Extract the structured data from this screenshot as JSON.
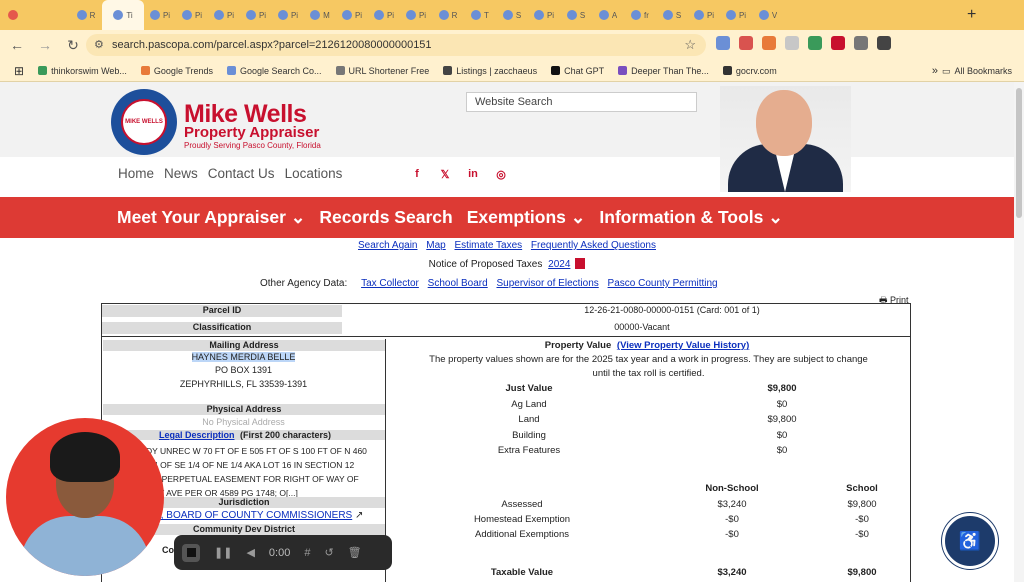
{
  "browser": {
    "tab_labels": [
      "R",
      "Ti",
      "Pi",
      "Pi",
      "Pi",
      "Pi",
      "Pi",
      "M",
      "Pi",
      "Pi",
      "Pi",
      "R",
      "T",
      "S",
      "Pi",
      "S",
      "A",
      "fr",
      "S",
      "Pi",
      "Pi",
      "V"
    ],
    "active_tab_label": "Pı",
    "url": "search.pascopa.com/parcel.aspx?parcel=2126120080000000151",
    "bookmarks": [
      "thinkorswim Web...",
      "Google Trends",
      "Google Search Co...",
      "URL Shortener Free",
      "Listings | zacchaeus",
      "Chat GPT",
      "Deeper Than The...",
      "gocrv.com"
    ],
    "all_bookmarks_label": "All Bookmarks"
  },
  "site": {
    "brand_name": "Mike Wells",
    "brand_sub": "Property Appraiser",
    "brand_tag": "Proudly Serving Pasco County, Florida",
    "seal_text": "PASCO COUNTY PROPERTY APPRAISER",
    "seal_mini_name": "MIKE WELLS",
    "search_placeholder": "Website Search",
    "nav_links": [
      "Home",
      "News",
      "Contact Us",
      "Locations"
    ],
    "social_icons": [
      "facebook-icon",
      "x-icon",
      "linkedin-icon",
      "instagram-icon"
    ],
    "main_nav": [
      "Meet Your Appraiser ⌄",
      "Records Search",
      "Exemptions ⌄",
      "Information & Tools ⌄"
    ]
  },
  "parcel_page": {
    "sub_links": [
      "Search Again",
      "Map",
      "Estimate Taxes",
      "Frequently Asked Questions"
    ],
    "notice_text": "Notice of Proposed Taxes",
    "notice_year": "2024",
    "agency_label": "Other Agency Data:",
    "agency_links": [
      "Tax Collector",
      "School Board",
      "Supervisor of Elections",
      "Pasco County Permitting"
    ],
    "print_label": "Print",
    "parcel_id_label": "Parcel ID",
    "parcel_id_value": "12-26-21-0080-00000-0151  (Card: 001 of 1)",
    "classification_label": "Classification",
    "classification_value": "00000-Vacant",
    "mailing_address_label": "Mailing Address",
    "owner_name": "HAYNES MERDIA BELLE",
    "mailing_line2": "PO BOX 1391",
    "mailing_line3": "ZEPHYRHILLS, FL 33539-1391",
    "physical_address_label": "Physical Address",
    "physical_address_value": "No Physical Address",
    "legal_desc_link": "Legal Description",
    "legal_desc_suffix": "(First 200 characters)",
    "legal_desc_lines": [
      "DY UNREC W 70 FT OF E 505 FT OF S 100 FT OF N 460",
      "1/4 OF SE 1/4 OF NE 1/4 AKA LOT 16 IN SECTION 12",
      "D A PERPETUAL EASEMENT FOR RIGHT OF WAY OF",
      "ILEY AVE PER OR 4589 PG 1748; O[...]"
    ],
    "jurisdiction_label": "Jurisdiction",
    "jurisdiction_value": "NTY, BOARD OF COUNTY COMMISSIONERS",
    "community_dev_label": "Community Dev District",
    "partial_label": "Co",
    "property_value_label": "Property Value",
    "value_history_link": "(View Property Value History)",
    "value_note_1": "The property values shown are for the 2025 tax year and a work in progress. They are subject to change",
    "value_note_2": "until the tax roll is certified.",
    "just_value_label": "Just Value",
    "just_value": "$9,800",
    "ag_land_label": "Ag Land",
    "ag_land": "$0",
    "land_label": "Land",
    "land": "$9,800",
    "building_label": "Building",
    "building": "$0",
    "extra_label": "Extra Features",
    "extra": "$0",
    "col_non_school": "Non-School",
    "col_school": "School",
    "assessed_label": "Assessed",
    "assessed_ns": "$3,240",
    "assessed_s": "$9,800",
    "homestead_label": "Homestead Exemption",
    "homestead_ns": "-$0",
    "homestead_s": "-$0",
    "additional_label": "Additional Exemptions",
    "additional_ns": "-$0",
    "additional_s": "-$0",
    "taxable_label": "Taxable Value",
    "taxable_ns": "$3,240",
    "taxable_s": "$9,800"
  },
  "recorder": {
    "time": "0:00"
  },
  "ada_badge": {
    "text": "ADA SITE COMPLIANCE"
  },
  "colors": {
    "brand_red": "#c8102e",
    "nav_red": "#dd3a34",
    "link_blue": "#0b2fbd",
    "tab_bar": "#f6c862"
  }
}
